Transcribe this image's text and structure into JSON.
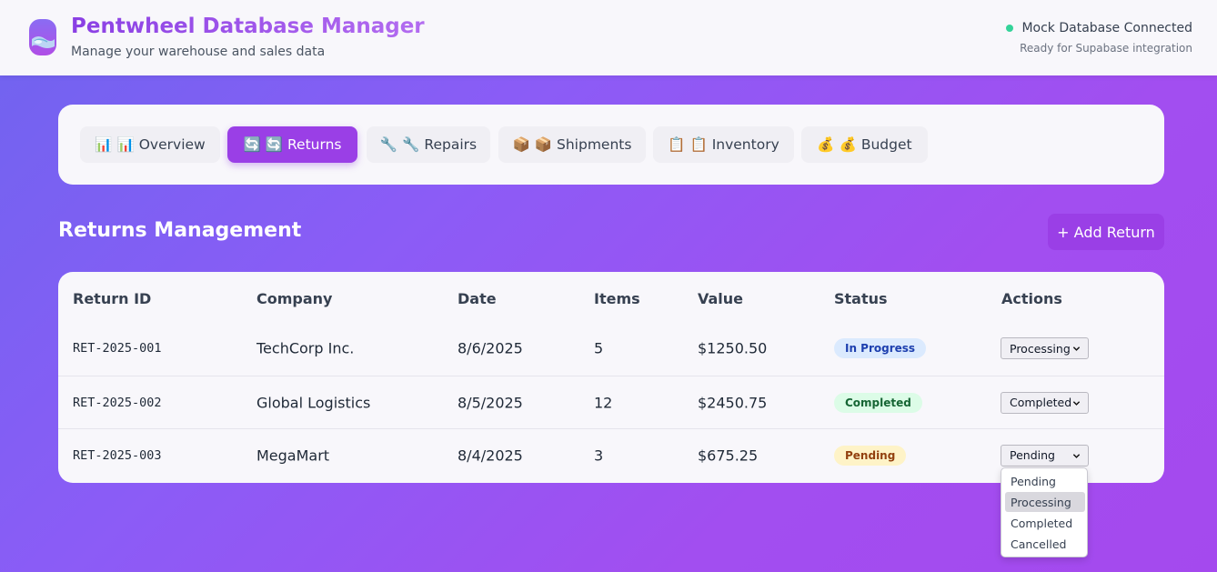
{
  "header": {
    "title": "Pentwheel Database Manager",
    "subtitle": "Manage your warehouse and sales data",
    "status": "Mock Database Connected",
    "status_sub": "Ready for Supabase integration"
  },
  "tabs": [
    {
      "label": "📊 📊 Overview"
    },
    {
      "label": "🔄 🔄 Returns",
      "active": true
    },
    {
      "label": "🔧 🔧 Repairs"
    },
    {
      "label": "📦 📦 Shipments"
    },
    {
      "label": "📋 📋 Inventory"
    },
    {
      "label": "💰 💰 Budget"
    }
  ],
  "section": {
    "title": "Returns Management",
    "add_label": "+ Add Return"
  },
  "table": {
    "headers": [
      "Return ID",
      "Company",
      "Date",
      "Items",
      "Value",
      "Status",
      "Actions"
    ],
    "rows": [
      {
        "id": "RET-2025-001",
        "company": "TechCorp Inc.",
        "date": "8/6/2025",
        "items": "5",
        "value": "$1250.50",
        "status": "In Progress",
        "action": "Processing"
      },
      {
        "id": "RET-2025-002",
        "company": "Global Logistics",
        "date": "8/5/2025",
        "items": "12",
        "value": "$2450.75",
        "status": "Completed",
        "action": "Completed"
      },
      {
        "id": "RET-2025-003",
        "company": "MegaMart",
        "date": "8/4/2025",
        "items": "3",
        "value": "$675.25",
        "status": "Pending",
        "action": "Pending"
      }
    ]
  },
  "dropdown": {
    "options": [
      "Pending",
      "Processing",
      "Completed",
      "Cancelled"
    ],
    "highlighted": "Processing"
  },
  "colors": {
    "accent": "#9a3fe6",
    "status_in_progress_bg": "#dbeafe",
    "status_in_progress_fg": "#1e40af",
    "status_completed_bg": "#dcfce7",
    "status_completed_fg": "#166534",
    "status_pending_bg": "#fef3c7",
    "status_pending_fg": "#92400e",
    "connected_dot": "#34d399"
  }
}
